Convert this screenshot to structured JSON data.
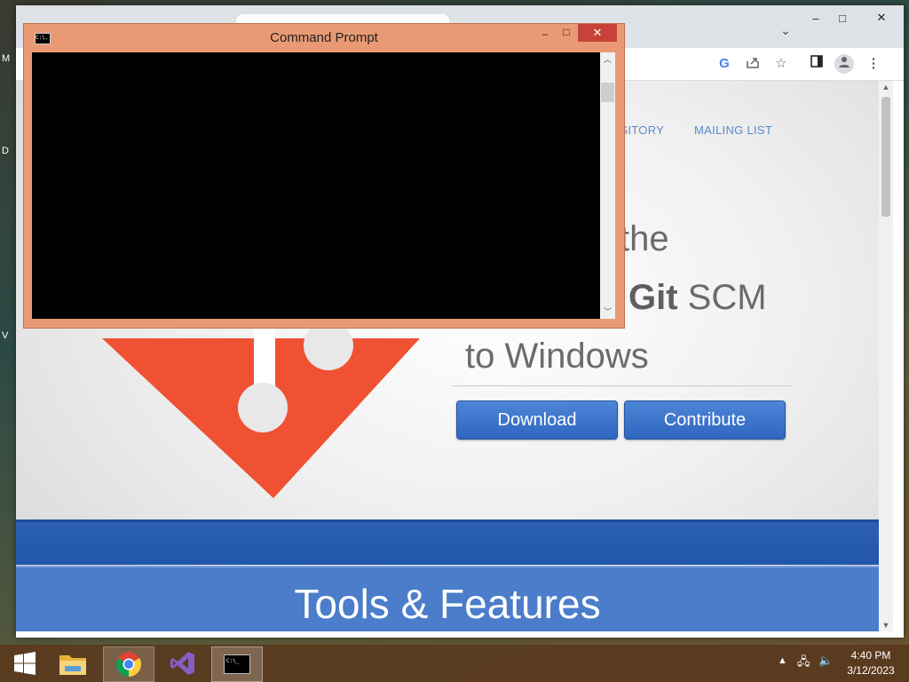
{
  "desktop": {
    "side_letters": [
      "M",
      "D",
      "V"
    ]
  },
  "chrome": {
    "window_controls": {
      "minimize": "–",
      "maximize": "□",
      "close": "✕"
    },
    "tab_search_icon": "chevron-down-icon",
    "toolbar_icons": [
      "google-icon",
      "share-icon",
      "bookmark-star-icon",
      "side-panel-icon",
      "profile-icon",
      "more-menu-icon"
    ],
    "google_glyph": "G"
  },
  "page": {
    "nav": {
      "repository": "OSITORY",
      "mailing_list": "MAILING LIST"
    },
    "hero": {
      "line1": "the",
      "line2_bold": "Git",
      "line2_rest": " SCM",
      "line3": "to Windows"
    },
    "buttons": {
      "download": "Download",
      "contribute": "Contribute"
    },
    "features_title": "Tools & Features",
    "colors": {
      "logo": "#f05133",
      "button": "#2f66bf",
      "band": "#2256ab",
      "band_light": "#4b7dca"
    }
  },
  "cmd": {
    "title": "Command Prompt",
    "icon_text": "C:\\.",
    "controls": {
      "minimize": "–",
      "maximize": "□",
      "close": "✕"
    }
  },
  "taskbar": {
    "apps": [
      "windows-start-icon",
      "file-explorer-icon",
      "chrome-icon",
      "visual-studio-icon",
      "command-prompt-icon"
    ],
    "time": "4:40 PM",
    "date": "3/12/2023"
  }
}
